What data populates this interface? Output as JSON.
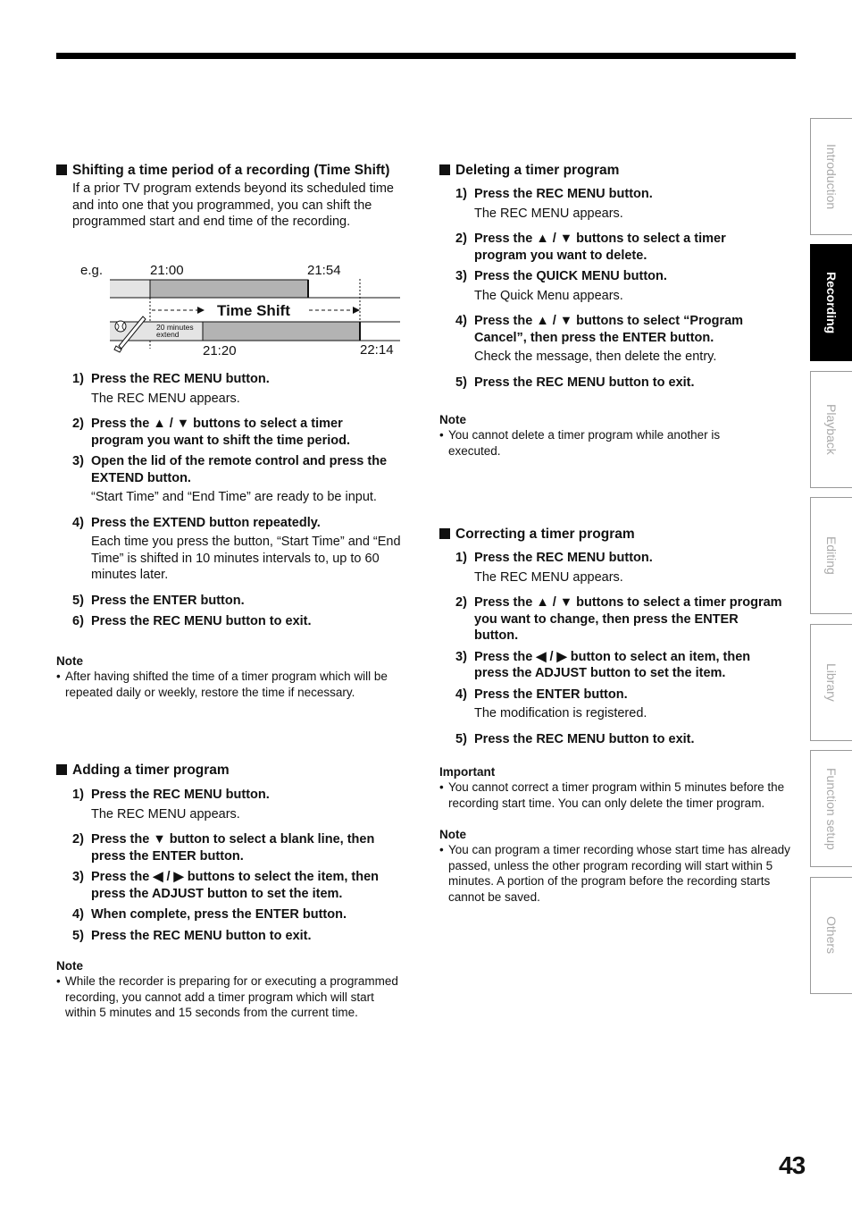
{
  "page_number": "43",
  "side_tabs": [
    {
      "label": "Introduction",
      "active": false
    },
    {
      "label": "Recording",
      "active": true
    },
    {
      "label": "Playback",
      "active": false
    },
    {
      "label": "Editing",
      "active": false
    },
    {
      "label": "Library",
      "active": false
    },
    {
      "label": "Function setup",
      "active": false
    },
    {
      "label": "Others",
      "active": false
    }
  ],
  "time_shift": {
    "title": "Shifting a time period of a recording (Time Shift)",
    "intro": "If a prior TV program extends beyond its scheduled time and into one that you programmed, you can shift the programmed start and end time of the recording.",
    "diagram": {
      "eg": "e.g.",
      "orig_start": "21:00",
      "orig_end": "21:54",
      "new_start": "21:20",
      "new_end": "22:14",
      "shift_label": "Time Shift",
      "extend_label_1": "20 minutes",
      "extend_label_2": "extend"
    },
    "steps": [
      {
        "num": "1)",
        "text": "Press the REC MENU button.",
        "sub": "The REC MENU appears."
      },
      {
        "num": "2)",
        "text": "Press the ▲ / ▼ buttons to select a timer program you want to shift the time period.",
        "sub": ""
      },
      {
        "num": "3)",
        "text": "Open the lid of the remote control and press the EXTEND button.",
        "sub": "“Start Time” and “End Time” are ready to be input."
      },
      {
        "num": "4)",
        "text": "Press the EXTEND button repeatedly.",
        "sub": "Each time you press the button, “Start Time” and “End Time” is shifted in 10 minutes intervals to, up to 60 minutes later."
      },
      {
        "num": "5)",
        "text": "Press the ENTER button.",
        "sub": ""
      },
      {
        "num": "6)",
        "text": "Press the REC MENU button to exit.",
        "sub": ""
      }
    ],
    "note_heading": "Note",
    "note": "After having shifted the time of a timer program which will be repeated daily or weekly, restore the time if necessary."
  },
  "adding": {
    "title": "Adding a timer program",
    "steps": [
      {
        "num": "1)",
        "text": "Press the REC MENU button.",
        "sub": "The REC MENU appears."
      },
      {
        "num": "2)",
        "text": "Press the ▼ button to select a blank line, then press the ENTER button.",
        "sub": ""
      },
      {
        "num": "3)",
        "text": "Press the ◀ / ▶ buttons to select the item, then press the ADJUST button to set the item.",
        "sub": ""
      },
      {
        "num": "4)",
        "text": "When complete, press the ENTER button.",
        "sub": ""
      },
      {
        "num": "5)",
        "text": "Press the REC MENU button to exit.",
        "sub": ""
      }
    ],
    "note_heading": "Note",
    "note": "While the recorder is preparing for or executing a programmed recording, you cannot add a timer program which will start within 5 minutes and 15 seconds from the current time."
  },
  "deleting": {
    "title": "Deleting a timer program",
    "steps": [
      {
        "num": "1)",
        "text": "Press the REC MENU button.",
        "sub": "The REC MENU appears."
      },
      {
        "num": "2)",
        "text": "Press the ▲ / ▼ buttons to select a timer program you want to delete.",
        "sub": ""
      },
      {
        "num": "3)",
        "text": "Press the QUICK MENU button.",
        "sub": "The Quick Menu appears."
      },
      {
        "num": "4)",
        "text": "Press the ▲ / ▼ buttons to select “Program Cancel”, then press the ENTER button.",
        "sub": "Check the message, then delete the entry."
      },
      {
        "num": "5)",
        "text": "Press the REC MENU button to exit.",
        "sub": ""
      }
    ],
    "note_heading": "Note",
    "note": "You cannot delete a timer program while another is executed."
  },
  "correcting": {
    "title": "Correcting a timer program",
    "steps": [
      {
        "num": "1)",
        "text": "Press the REC MENU button.",
        "sub": "The REC MENU appears."
      },
      {
        "num": "2)",
        "text": "Press the ▲ / ▼ buttons to select a timer program you want to change, then press the ENTER button.",
        "sub": ""
      },
      {
        "num": "3)",
        "text": "Press the ◀ / ▶ button to select an item, then press the ADJUST button to set the item.",
        "sub": ""
      },
      {
        "num": "4)",
        "text": "Press the ENTER button.",
        "sub": "The modification is registered."
      },
      {
        "num": "5)",
        "text": "Press the REC MENU button to exit.",
        "sub": ""
      }
    ],
    "important_heading": "Important",
    "important": "You cannot correct a timer program within 5 minutes before the recording start time. You can only delete the timer program.",
    "note_heading": "Note",
    "note": "You can program a timer recording whose start time has already passed, unless the other program recording will start within 5 minutes. A portion of the program before the recording starts cannot be saved."
  }
}
